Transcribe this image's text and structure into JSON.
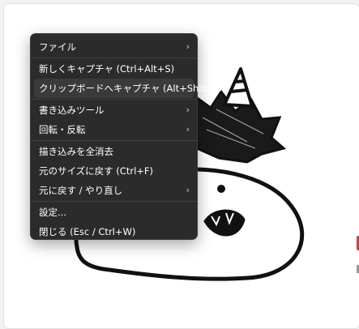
{
  "menu": {
    "items": [
      {
        "label": "ファイル",
        "submenu_arrow": "›"
      },
      {
        "label": "新しくキャプチャ (Ctrl+Alt+S)"
      },
      {
        "label": "クリップボードへキャプチャ (Alt+Shift+S)"
      },
      {
        "label": "書き込みツール",
        "submenu_arrow": "›"
      },
      {
        "label": "回転・反転",
        "submenu_arrow": "›"
      },
      {
        "label": "描き込みを全消去"
      },
      {
        "label": "元のサイズに戻す (Ctrl+F)"
      },
      {
        "label": "元に戻す / やり直し",
        "submenu_arrow": "›"
      },
      {
        "label": "設定..."
      },
      {
        "label": "閉じる (Esc / Ctrl+W)"
      }
    ]
  },
  "canvas": {
    "subject": "oni-monster-sketch-image"
  },
  "colors": {
    "menu_background": "#2b2b2b",
    "menu_text": "#ffffff",
    "canvas_background": "#ffffff",
    "edge_accent": "#b44a4a"
  }
}
